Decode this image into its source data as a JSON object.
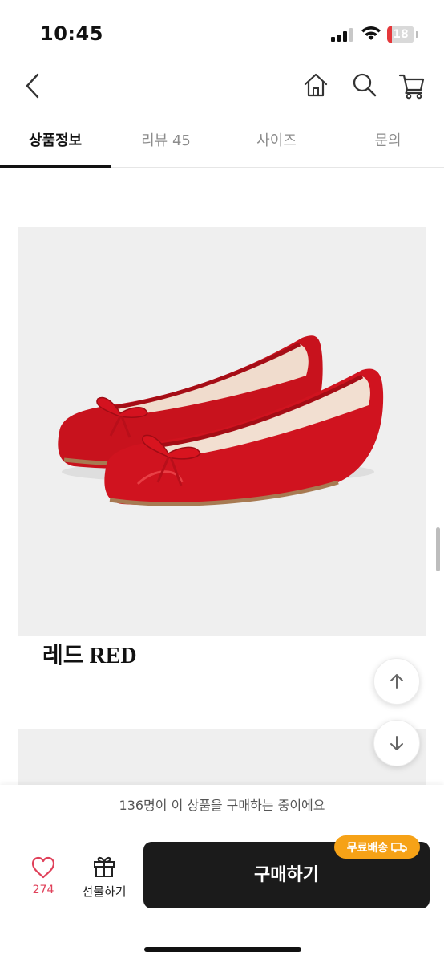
{
  "status_bar": {
    "time": "10:45",
    "battery": "18",
    "battery_level": 0.18
  },
  "header": {
    "back_icon": "chevron-left-icon",
    "home_icon": "home-icon",
    "search_icon": "search-icon",
    "cart_icon": "cart-icon"
  },
  "tabs": [
    {
      "label": "상품정보",
      "active": true
    },
    {
      "label": "리뷰 45",
      "active": false
    },
    {
      "label": "사이즈",
      "active": false
    },
    {
      "label": "문의",
      "active": false
    }
  ],
  "content": {
    "image_caption": "레드 RED",
    "image_subject": "red patent leather ballet flats with bow"
  },
  "floating": {
    "up_icon": "arrow-up-icon",
    "down_icon": "arrow-down-icon"
  },
  "bottom_bar": {
    "notice": "136명이 이 상품을 구매하는 중이에요",
    "like_count": "274",
    "gift_label": "선물하기",
    "buy_label": "구매하기",
    "shipping_badge": "무료배송",
    "accent_color": "#f6a217",
    "like_color": "#e0415a"
  }
}
